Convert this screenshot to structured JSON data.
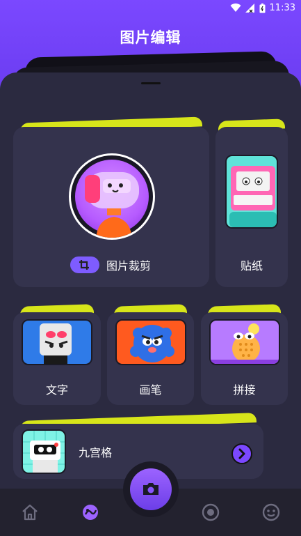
{
  "status_bar": {
    "time": "11:33"
  },
  "header": {
    "title": "图片编辑"
  },
  "tools": {
    "crop": {
      "label": "图片裁剪"
    },
    "sticker": {
      "label": "贴纸"
    },
    "text": {
      "label": "文字"
    },
    "brush": {
      "label": "画笔"
    },
    "collage": {
      "label": "拼接"
    },
    "grid": {
      "label": "九宫格"
    }
  },
  "colors": {
    "accent": "#7b48ff",
    "tab_yellow": "#d7e51a",
    "card_bg": "#34334d",
    "sheet_bg": "#2b2a40"
  },
  "nav": {
    "items": [
      {
        "icon": "home-icon"
      },
      {
        "icon": "editor-icon",
        "active": true
      },
      {
        "icon": "camera-icon"
      },
      {
        "icon": "record-icon"
      },
      {
        "icon": "smiley-icon"
      }
    ]
  }
}
